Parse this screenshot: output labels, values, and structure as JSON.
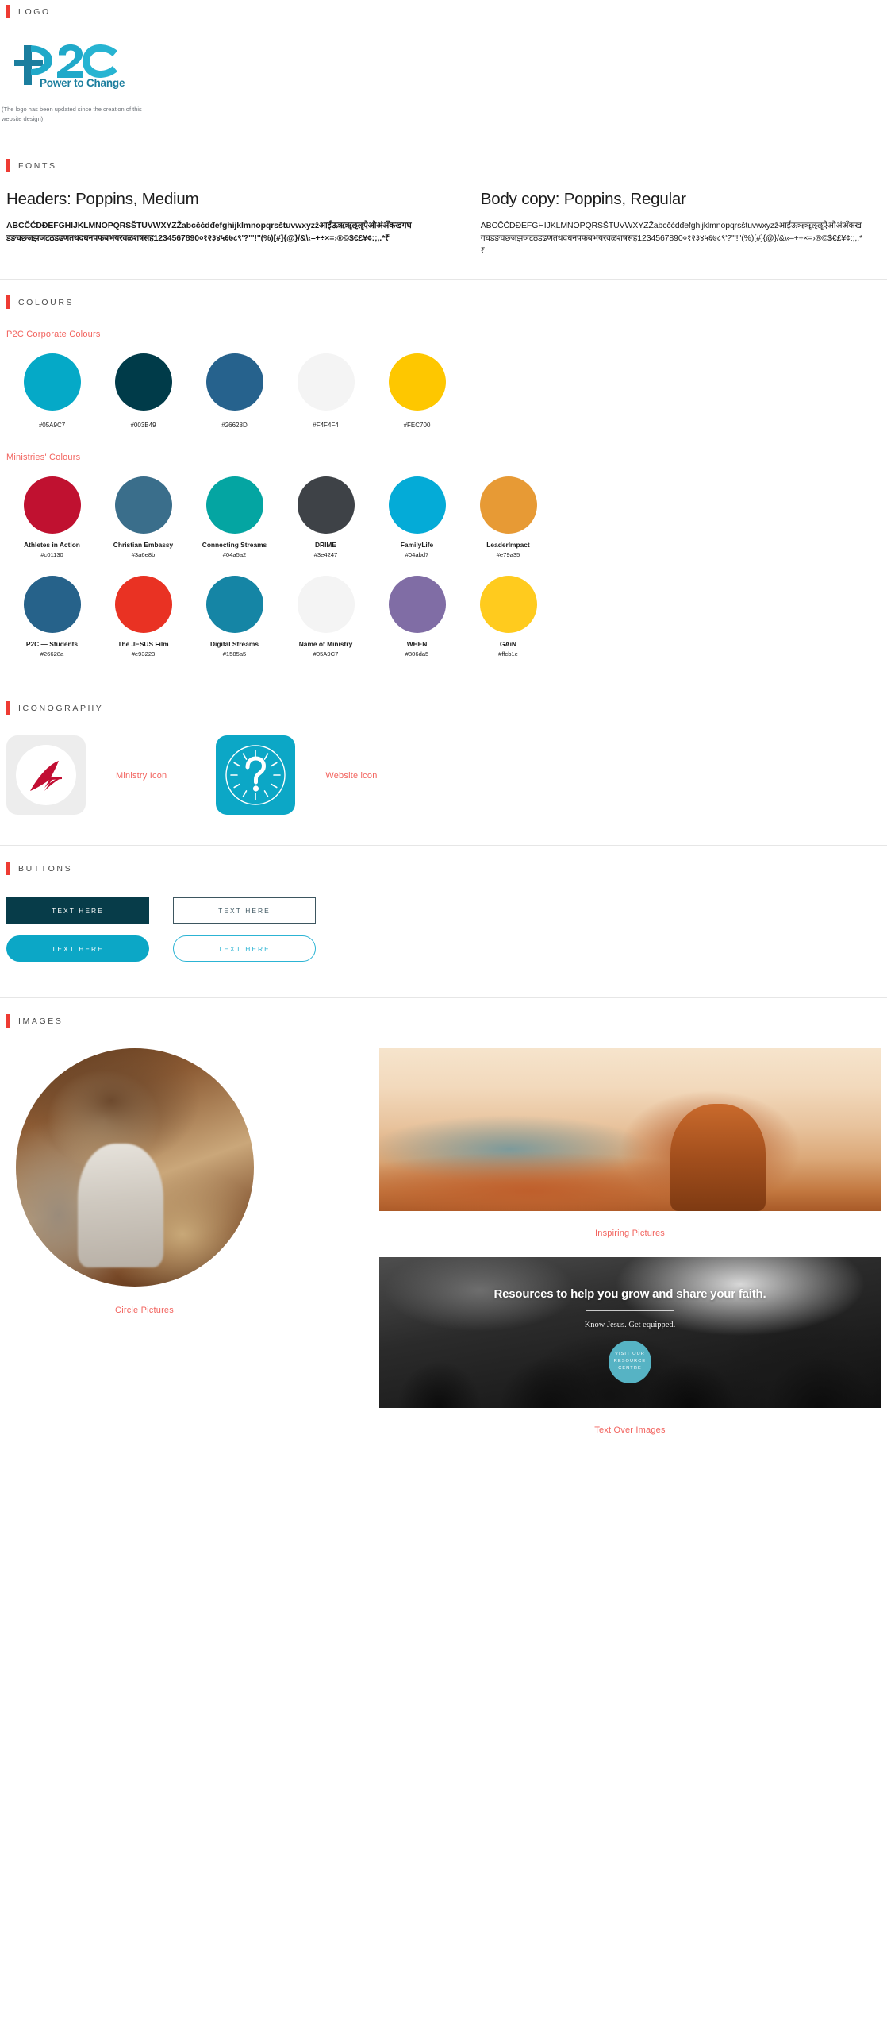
{
  "sections": {
    "logo": "LOGO",
    "fonts": "FONTS",
    "colours": "COLOURS",
    "iconography": "ICONOGRAPHY",
    "buttons": "BUTTONS",
    "images": "IMAGES"
  },
  "logo": {
    "wordmark": "P2C",
    "tagline": "Power to Change",
    "note": "(The logo has been updated since the creation of this website design)"
  },
  "fonts": {
    "header": {
      "title": "Headers: Poppins, Medium",
      "specimen": "ABCČĆDĐEFGHIJKLMNOPQRSŠTUVWXYZŽabcčćdđefghijklmnopqrsštuvwxyzžआईऊऋॠऌॡऐऔअंअँकखगघडङचछजझञटठडढणतथदधनपफबभयरवळशषसह1234567890०१२३४५६७८९'?'''!''(%)[#]{@}/&\\‹–+÷×=›®©$€£¥¢:;,.*₹"
    },
    "body": {
      "title": "Body copy: Poppins, Regular",
      "specimen": "ABCČĆDĐEFGHIJKLMNOPQRSŠTUVWXYZŽabcčćdđefghijklmnopqrsštuvwxyzžआईऊऋॠऌॡऐऔअंअँकखगघडङचछजझञटठडढणतथदधनपफबभयरवळशषसह1234567890०१२३४५६७८९'?'''!''(%)[#]{@}/&\\‹–+÷×=›®©$€£¥¢:;,.*₹"
    }
  },
  "colours": {
    "corporate_heading": "P2C Corporate Colours",
    "ministries_heading": "Ministries' Colours",
    "corporate": [
      {
        "hex": "#05A9C7",
        "swatch": "#05A9C7"
      },
      {
        "hex": "#003B49",
        "swatch": "#003B49"
      },
      {
        "hex": "#26628D",
        "swatch": "#26628D"
      },
      {
        "hex": "#F4F4F4",
        "swatch": "#F4F4F4"
      },
      {
        "hex": "#FEC700",
        "swatch": "#FEC700"
      }
    ],
    "ministries_row1": [
      {
        "name": "Athletes in Action",
        "hex": "#c01130",
        "swatch": "#c01130"
      },
      {
        "name": "Christian Embassy",
        "hex": "#3a6e8b",
        "swatch": "#3a6e8b"
      },
      {
        "name": "Connecting Streams",
        "hex": "#04a5a2",
        "swatch": "#04a5a2"
      },
      {
        "name": "DRIME",
        "hex": "#3e4247",
        "swatch": "#3e4247"
      },
      {
        "name": "FamilyLife",
        "hex": "#04abd7",
        "swatch": "#04abd7"
      },
      {
        "name": "LeaderImpact",
        "hex": "#e79a35",
        "swatch": "#e79a35"
      }
    ],
    "ministries_row2": [
      {
        "name": "P2C — Students",
        "hex": "#26628a",
        "swatch": "#26628a"
      },
      {
        "name": "The JESUS Film",
        "hex": "#e93223",
        "swatch": "#e93223"
      },
      {
        "name": "Digital Streams",
        "hex": "#1585a5",
        "swatch": "#1585a5"
      },
      {
        "name": "Name of Ministry",
        "hex": "#05A9C7",
        "swatch": "#f4f4f4"
      },
      {
        "name": "WHEN",
        "hex": "#806da5",
        "swatch": "#806da5"
      },
      {
        "name": "GAiN",
        "hex": "#ffcb1e",
        "swatch": "#ffcb1e"
      }
    ]
  },
  "iconography": {
    "ministry_icon_caption": "Ministry Icon",
    "website_icon_caption": "Website icon"
  },
  "buttons": {
    "solid_dark": "TEXT HERE",
    "outline_dark": "TEXT HERE",
    "solid_cyan": "TEXT HERE",
    "outline_cyan": "TEXT HERE"
  },
  "images": {
    "circle_caption": "Circle Pictures",
    "inspiring_caption": "Inspiring Pictures",
    "text_over_caption": "Text Over Images",
    "banner": {
      "headline": "Resources to help you grow and share your faith.",
      "subhead": "Know Jesus. Get equipped.",
      "cta_line1": "VISIT OUR",
      "cta_line2": "RESOURCE",
      "cta_line3": "CENTRE"
    }
  }
}
